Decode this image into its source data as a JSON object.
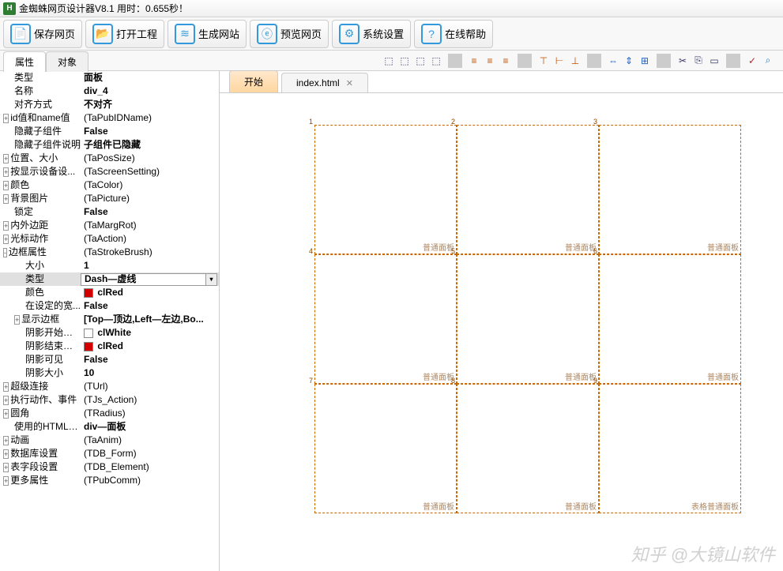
{
  "title": "金蜘蛛网页设计器V8.1  用时：0.655秒！",
  "maintoolbar": [
    {
      "label": "保存网页",
      "color": "#3399dd"
    },
    {
      "label": "打开工程",
      "color": "#3399dd"
    },
    {
      "label": "生成网站",
      "color": "#3399dd"
    },
    {
      "label": "预览网页",
      "color": "#3399dd"
    },
    {
      "label": "系统设置",
      "color": "#3399dd"
    },
    {
      "label": "在线帮助",
      "color": "#3399dd"
    }
  ],
  "panelTabs": {
    "active": "属性",
    "other": "对象"
  },
  "docTabs": {
    "start": "开始",
    "file": "index.html"
  },
  "props": [
    {
      "exp": "",
      "ind": 0,
      "label": "类型",
      "value": "面板",
      "bold": true
    },
    {
      "exp": "",
      "ind": 0,
      "label": "名称",
      "value": "div_4",
      "bold": true
    },
    {
      "exp": "",
      "ind": 0,
      "label": "对齐方式",
      "value": "不对齐",
      "bold": true
    },
    {
      "exp": "+",
      "ind": 0,
      "label": "id值和name值",
      "value": "(TaPubIDName)"
    },
    {
      "exp": "",
      "ind": 0,
      "label": "隐藏子组件",
      "value": "False",
      "bold": true
    },
    {
      "exp": "",
      "ind": 0,
      "label": "隐藏子组件说明",
      "value": "子组件已隐藏",
      "bold": true
    },
    {
      "exp": "+",
      "ind": 0,
      "label": "位置、大小",
      "value": "(TaPosSize)"
    },
    {
      "exp": "+",
      "ind": 0,
      "label": "按显示设备设...",
      "value": "(TaScreenSetting)"
    },
    {
      "exp": "+",
      "ind": 0,
      "label": "颜色",
      "value": "(TaColor)"
    },
    {
      "exp": "+",
      "ind": 0,
      "label": "背景图片",
      "value": "(TaPicture)"
    },
    {
      "exp": "",
      "ind": 0,
      "label": "锁定",
      "value": "False",
      "bold": true
    },
    {
      "exp": "+",
      "ind": 0,
      "label": "内外边距",
      "value": "(TaMargRot)"
    },
    {
      "exp": "+",
      "ind": 0,
      "label": "光标动作",
      "value": "(TaAction)"
    },
    {
      "exp": "-",
      "ind": 0,
      "label": "边框属性",
      "value": "(TaStrokeBrush)"
    },
    {
      "exp": "",
      "ind": 1,
      "label": "大小",
      "value": "1",
      "bold": true
    },
    {
      "exp": "",
      "ind": 1,
      "label": "类型",
      "value": "Dash—虚线",
      "bold": true,
      "selected": true,
      "dropdown": true
    },
    {
      "exp": "",
      "ind": 1,
      "label": "颜色",
      "value": "clRed",
      "bold": true,
      "swatch": "#d40000"
    },
    {
      "exp": "",
      "ind": 1,
      "label": "在设定的宽...",
      "value": "False",
      "bold": true
    },
    {
      "exp": "+",
      "ind": 1,
      "label": "显示边框",
      "value": "[Top—顶边,Left—左边,Bo...",
      "bold": true
    },
    {
      "exp": "",
      "ind": 1,
      "label": "阴影开始颜色",
      "value": "clWhite",
      "bold": true,
      "swatch": "#ffffff"
    },
    {
      "exp": "",
      "ind": 1,
      "label": "阴影结束颜色",
      "value": "clRed",
      "bold": true,
      "swatch": "#d40000"
    },
    {
      "exp": "",
      "ind": 1,
      "label": "阴影可见",
      "value": "False",
      "bold": true
    },
    {
      "exp": "",
      "ind": 1,
      "label": "阴影大小",
      "value": "10",
      "bold": true
    },
    {
      "exp": "+",
      "ind": 0,
      "label": "超级连接",
      "value": "(TUrl)"
    },
    {
      "exp": "+",
      "ind": 0,
      "label": "执行动作、事件",
      "value": "(TJs_Action)"
    },
    {
      "exp": "+",
      "ind": 0,
      "label": "圆角",
      "value": "(TRadius)"
    },
    {
      "exp": "",
      "ind": 0,
      "label": "使用的HTML对象",
      "value": "div—面板",
      "bold": true
    },
    {
      "exp": "+",
      "ind": 0,
      "label": "动画",
      "value": "(TaAnim)"
    },
    {
      "exp": "+",
      "ind": 0,
      "label": "数据库设置",
      "value": "(TDB_Form)"
    },
    {
      "exp": "+",
      "ind": 0,
      "label": "表字段设置",
      "value": "(TDB_Element)"
    },
    {
      "exp": "+",
      "ind": 0,
      "label": "更多属性",
      "value": "(TPubComm)"
    }
  ],
  "cells": {
    "label": "普通面板",
    "lastLabel": "表格普通面板",
    "cols": 3,
    "rows": 3,
    "w": 180,
    "h": 164
  },
  "watermark": "知乎 @大镜山软件"
}
